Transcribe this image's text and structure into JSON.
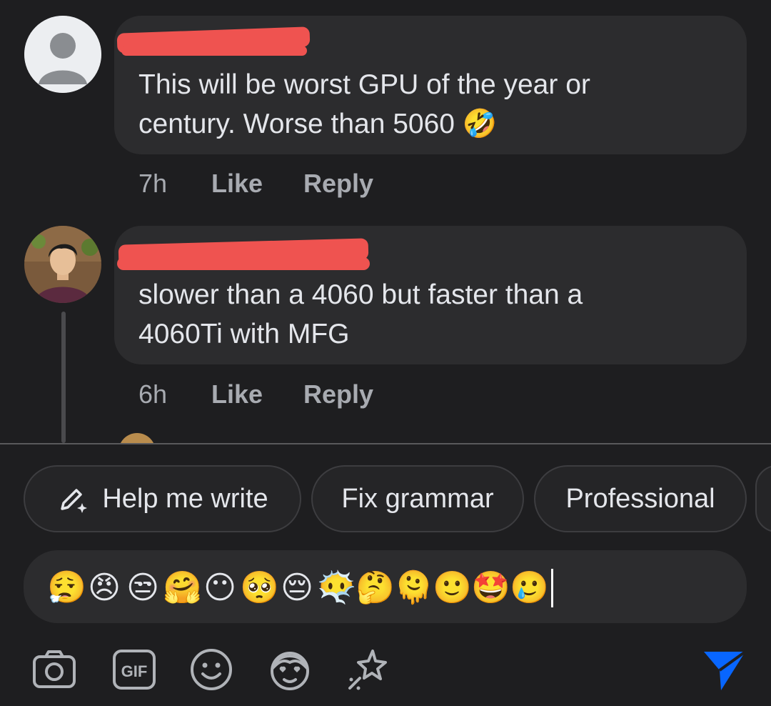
{
  "comments": [
    {
      "text_line1": "This will be worst GPU of the year or",
      "text_line2": "century. Worse than 5060 🤣",
      "time": "7h",
      "like_label": "Like",
      "reply_label": "Reply"
    },
    {
      "text_line1": "slower than a 4060 but faster than a",
      "text_line2": "4060Ti with MFG",
      "time": "6h",
      "like_label": "Like",
      "reply_label": "Reply"
    }
  ],
  "suggestions": [
    {
      "label": "Help me write",
      "icon": "pencil-sparkle-icon"
    },
    {
      "label": "Fix grammar"
    },
    {
      "label": "Professional"
    }
  ],
  "composer": {
    "emojis": [
      "😮‍💨",
      "😠",
      "😒",
      "🤗",
      "😶",
      "🥺",
      "😔",
      "😶‍🌫️",
      "🤔",
      "🫠",
      "🙂",
      "🤩",
      "🥲"
    ]
  },
  "toolbar": {
    "icons": [
      "camera-icon",
      "gif-icon",
      "emoji-icon",
      "avatar-sticker-icon",
      "sparkle-effects-icon"
    ],
    "send_icon": "send-icon"
  },
  "colors": {
    "background": "#1e1e20",
    "bubble": "#2c2c2e",
    "accent": "#0866ff",
    "redaction": "#ef5350"
  }
}
